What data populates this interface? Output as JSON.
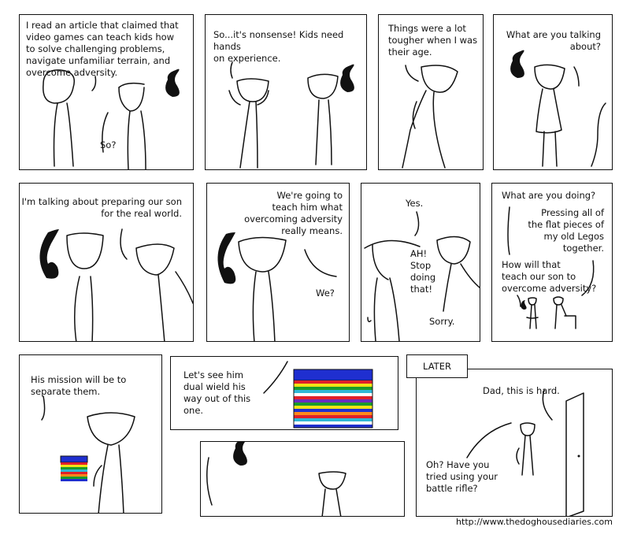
{
  "panels": {
    "p1": {
      "text": "I read an article that claimed that\nvideo games can teach kids how\nto solve challenging problems,\nnavigate unfamiliar terrain, and\novercome adversity.",
      "reply": "So?"
    },
    "p2": {
      "text": "So...it's nonsense!  Kids need hands\non experience."
    },
    "p3": {
      "text": "Things were a lot\ntougher when I was\ntheir age."
    },
    "p4": {
      "text": "What are you talking\nabout?"
    },
    "p5": {
      "text": "I'm talking about preparing our son\nfor the real world."
    },
    "p6": {
      "text": "We're going to\nteach him what\novercoming adversity\nreally means.",
      "reply": "We?"
    },
    "p7": {
      "top": "Yes.",
      "shout": "AH!\nStop\ndoing\nthat!",
      "reply": "Sorry."
    },
    "p8": {
      "q": "What are you doing?",
      "a": "Pressing all of\nthe flat pieces of\nmy old Legos\ntogether.",
      "q2": "How will that\nteach our son to\novercome adversity?"
    },
    "p9": {
      "text": "His mission will be to\nseparate them."
    },
    "p10": {
      "text": "Let's see him\ndual wield his\nway out of this\none."
    },
    "p12": {
      "caption": "LATER",
      "top": "Dad, this is hard.",
      "bottom": "Oh?  Have you\ntried using your\nbattle rifle?"
    }
  },
  "footer": {
    "url": "http://www.thedoghousediaries.com"
  },
  "colors": {
    "ink": "#111111",
    "lego": [
      "#1f2fd0",
      "#e0202a",
      "#f2e316",
      "#1a9b2a",
      "#2fb8d6",
      "#ffffff",
      "#ff8a1c",
      "#6a2cc0"
    ]
  }
}
